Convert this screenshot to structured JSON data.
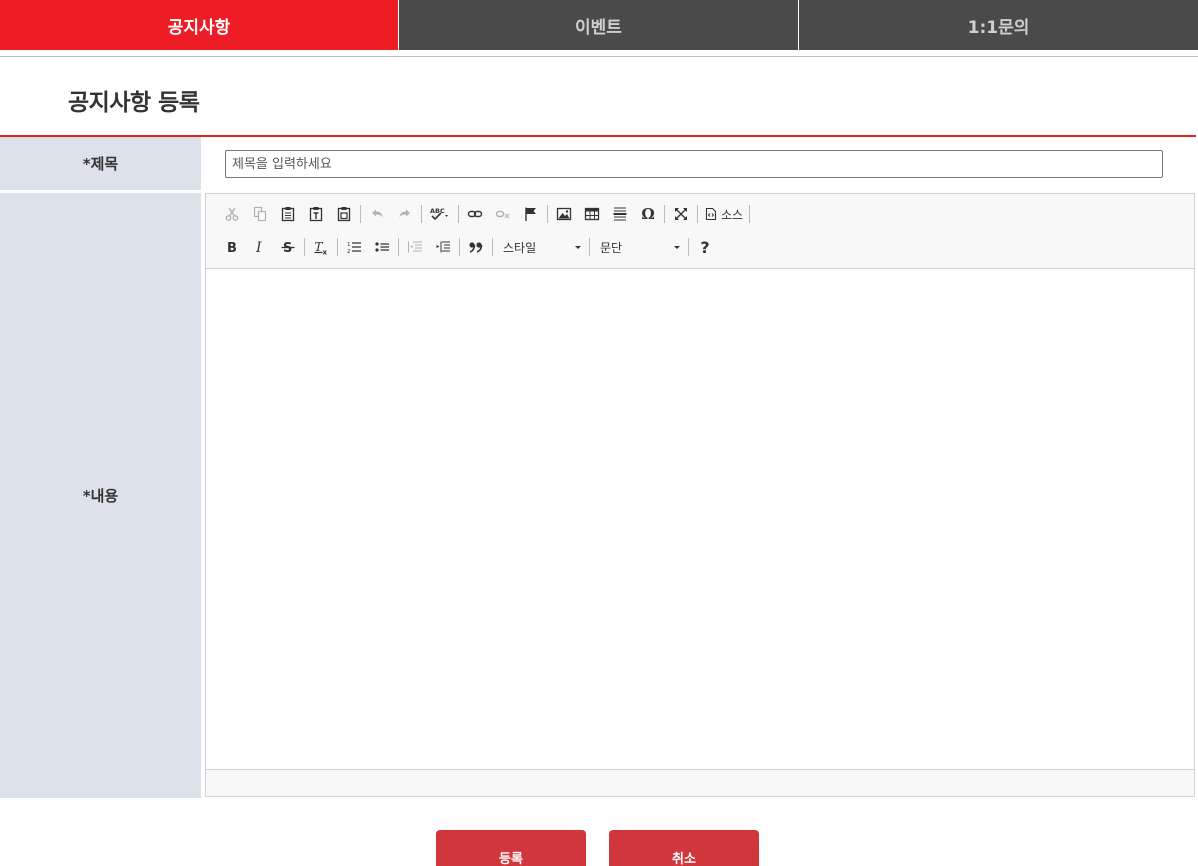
{
  "tabs": [
    {
      "label": "공지사항",
      "active": true
    },
    {
      "label": "이벤트",
      "active": false
    },
    {
      "label": "1:1문의",
      "active": false
    }
  ],
  "page_title": "공지사항 등록",
  "form": {
    "title_label": "*제목",
    "title_placeholder": "제목을 입력하세요",
    "title_value": "",
    "content_label": "*내용"
  },
  "editor": {
    "toolbar_row1": [
      "cut-icon",
      "copy-icon",
      "paste-icon",
      "paste-text-icon",
      "paste-word-icon",
      "undo-icon",
      "redo-icon",
      "spellcheck-icon",
      "link-icon",
      "unlink-icon",
      "anchor-icon",
      "image-icon",
      "table-icon",
      "horizontal-rule-icon",
      "special-char-icon",
      "maximize-icon",
      "source-icon"
    ],
    "source_label": "소스",
    "toolbar_row2": [
      "bold-icon",
      "italic-icon",
      "strike-icon",
      "remove-format-icon",
      "numbered-list-icon",
      "bulleted-list-icon",
      "outdent-icon",
      "indent-icon",
      "blockquote-icon",
      "help-icon"
    ],
    "style_dropdown": "스타일",
    "format_dropdown": "문단",
    "help_glyph": "?"
  },
  "buttons": {
    "submit": "등록",
    "cancel": "취소"
  },
  "colors": {
    "accent": "#ee1c25",
    "tab_inactive": "#4a4a4a",
    "label_bg": "#dde2ea",
    "button": "#d0363b"
  }
}
